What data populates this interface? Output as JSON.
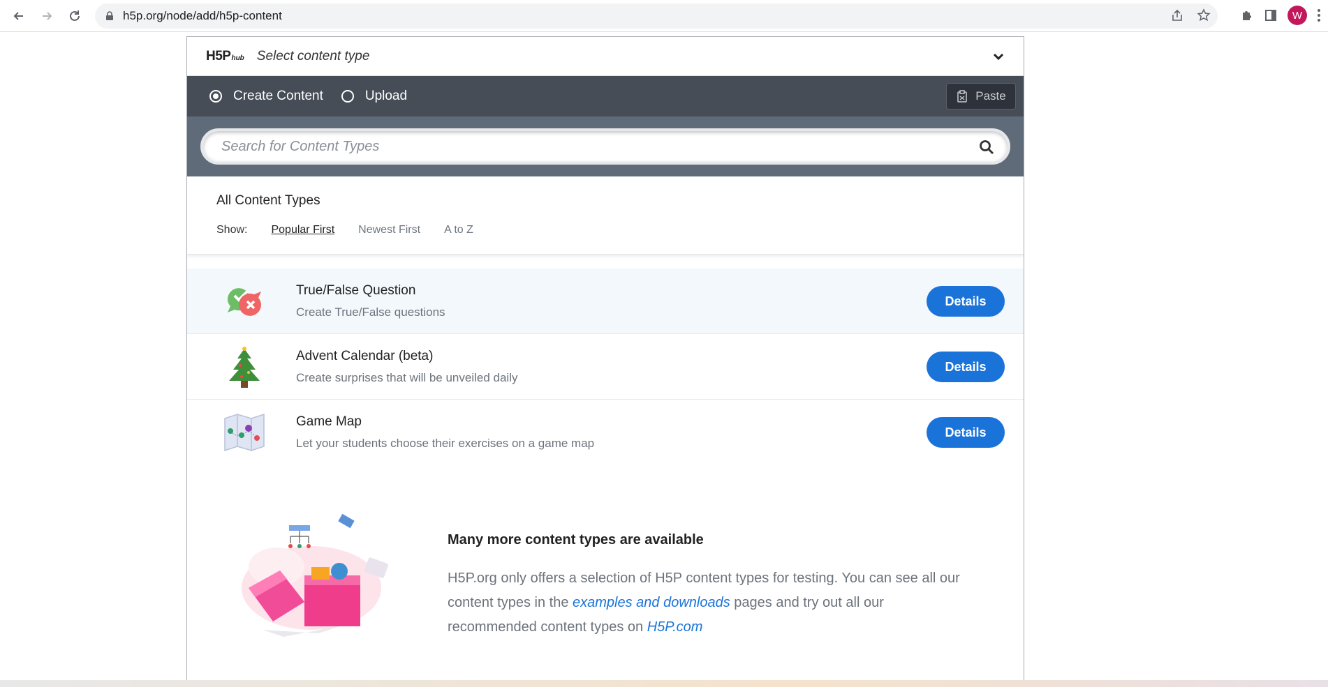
{
  "browser": {
    "url": "h5p.org/node/add/h5p-content",
    "avatar_letter": "W"
  },
  "hub": {
    "logo_text": "H5P",
    "logo_sub": "hub",
    "title": "Select content type",
    "tabs": [
      {
        "label": "Create Content",
        "selected": true
      },
      {
        "label": "Upload",
        "selected": false
      }
    ],
    "paste_label": "Paste",
    "search_placeholder": "Search for Content Types"
  },
  "content_types": {
    "title": "All Content Types",
    "show_label": "Show:",
    "sort_options": [
      {
        "label": "Popular First",
        "active": true
      },
      {
        "label": "Newest First",
        "active": false
      },
      {
        "label": "A to Z",
        "active": false
      }
    ],
    "items": [
      {
        "name": "True/False Question",
        "description": "Create True/False questions",
        "button": "Details",
        "icon": "true-false-icon"
      },
      {
        "name": "Advent Calendar (beta)",
        "description": "Create surprises that will be unveiled daily",
        "button": "Details",
        "icon": "christmas-tree-icon"
      },
      {
        "name": "Game Map",
        "description": "Let your students choose their exercises on a game map",
        "button": "Details",
        "icon": "game-map-icon"
      }
    ]
  },
  "more": {
    "title": "Many more content types are available",
    "body_1": "H5P.org only offers a selection of H5P content types for testing. You can see all our content types in the ",
    "link_1": "examples and downloads",
    "body_2": " pages and try out all our recommended content types on ",
    "link_2": "H5P.com"
  },
  "colors": {
    "accent": "#1a73d9",
    "tab_bar": "#474d56",
    "search_bar": "#5f6b78"
  }
}
